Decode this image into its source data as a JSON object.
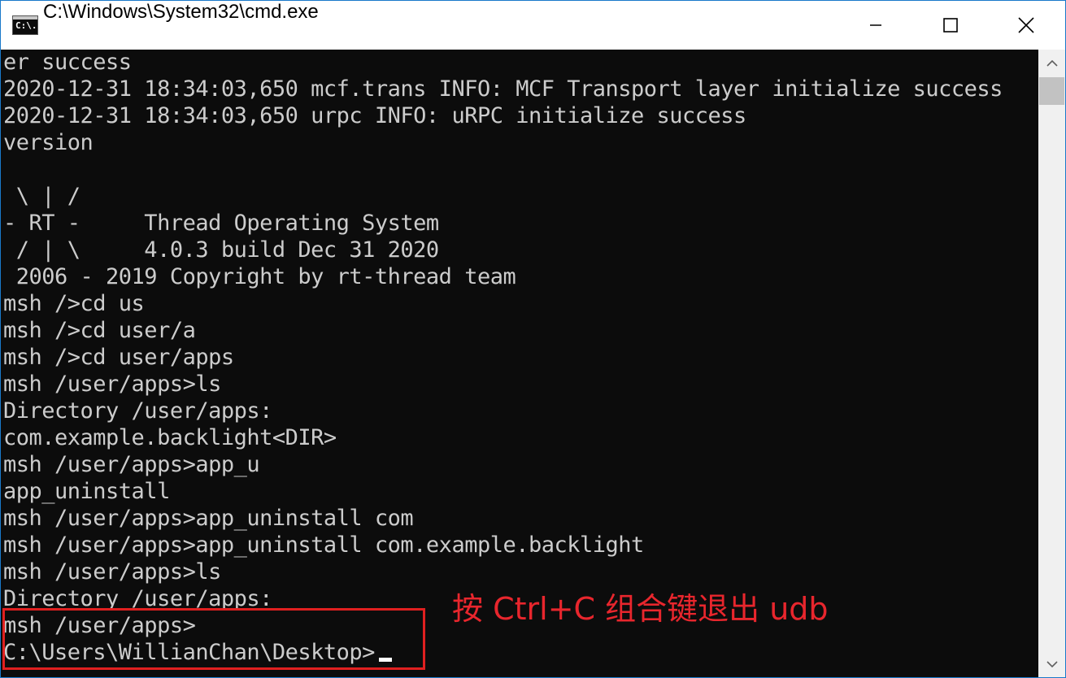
{
  "window": {
    "title": "C:\\Windows\\System32\\cmd.exe",
    "icon_label": "C:\\."
  },
  "terminal": {
    "lines": [
      "er success",
      "2020-12-31 18:34:03,650 mcf.trans INFO: MCF Transport layer initialize success",
      "2020-12-31 18:34:03,650 urpc INFO: uRPC initialize success",
      "version",
      "",
      " \\ | /",
      "- RT -     Thread Operating System",
      " / | \\     4.0.3 build Dec 31 2020",
      " 2006 - 2019 Copyright by rt-thread team",
      "msh />cd us",
      "msh />cd user/a",
      "msh />cd user/apps",
      "msh /user/apps>ls",
      "Directory /user/apps:",
      "com.example.backlight<DIR>",
      "msh /user/apps>app_u",
      "app_uninstall",
      "msh /user/apps>app_uninstall com",
      "msh /user/apps>app_uninstall com.example.backlight",
      "msh /user/apps>ls",
      "Directory /user/apps:",
      "msh /user/apps>",
      "C:\\Users\\WillianChan\\Desktop>"
    ]
  },
  "annotation": {
    "text": "按 Ctrl+C 组合键退出 udb",
    "color": "#e8262d"
  },
  "colors": {
    "terminal_bg": "#0c0c0c",
    "terminal_fg": "#cccccc",
    "titlebar_bg": "#ffffff",
    "highlight": "#e02020"
  }
}
